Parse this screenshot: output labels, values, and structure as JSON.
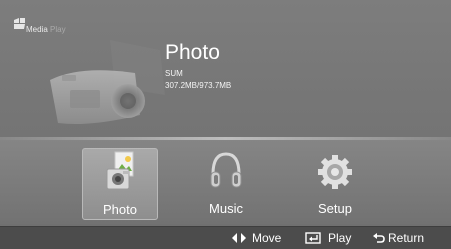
{
  "brand": {
    "name_main": "Media",
    "name_dim": " Play"
  },
  "selected": {
    "title": "Photo",
    "device": "SUM",
    "storage": "307.2MB/973.7MB"
  },
  "menu": [
    {
      "label": "Photo",
      "icon": "photo-icon"
    },
    {
      "label": "Music",
      "icon": "headphones-icon"
    },
    {
      "label": "Setup",
      "icon": "gear-icon"
    }
  ],
  "hints": [
    {
      "label": "Move",
      "icon": "arrows-left-right-icon"
    },
    {
      "label": "Play",
      "icon": "enter-icon"
    },
    {
      "label": "Return",
      "icon": "return-icon"
    }
  ],
  "colors": {
    "background": "#777777",
    "bottom_bar": "#4c4c4c",
    "text": "#ffffff"
  }
}
